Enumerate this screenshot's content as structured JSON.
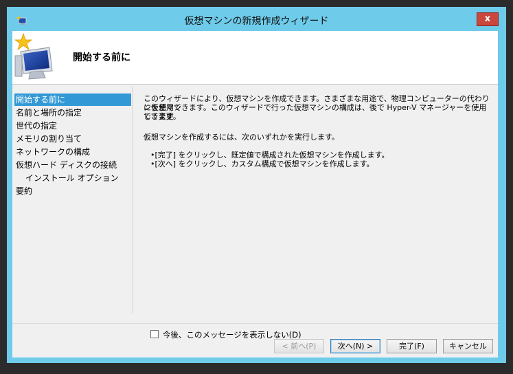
{
  "window": {
    "title": "仮想マシンの新規作成ウィザード",
    "close_label": "x"
  },
  "header": {
    "title": "開始する前に"
  },
  "nav": {
    "items": [
      {
        "label": "開始する前に",
        "selected": true
      },
      {
        "label": "名前と場所の指定",
        "selected": false
      },
      {
        "label": "世代の指定",
        "selected": false
      },
      {
        "label": "メモリの割り当て",
        "selected": false
      },
      {
        "label": "ネットワークの構成",
        "selected": false
      },
      {
        "label": "仮想ハード ディスクの接続",
        "selected": false
      },
      {
        "label": "インストール オプション",
        "selected": false
      },
      {
        "label": "要約",
        "selected": false
      }
    ]
  },
  "content": {
    "intro_line1": "このウィザードにより、仮想マシンを作成できます。さまざまな用途で、物理コンピューターの代わりに仮想マシ",
    "intro_line2": "ンを使用できます。このウィザードで行った仮想マシンの構成は、後で Hyper-V マネージャーを使用して変更",
    "intro_line3": "できます。",
    "instruction": "仮想マシンを作成するには、次のいずれかを実行します。",
    "bullet1": "•[完了] をクリックし、既定値で構成された仮想マシンを作成します。",
    "bullet2": "•[次へ] をクリックし、カスタム構成で仮想マシンを作成します。"
  },
  "checkbox": {
    "label": "今後、このメッセージを表示しない(D)",
    "checked": false
  },
  "buttons": {
    "prev": "< 前へ(P)",
    "next": "次へ(N) >",
    "finish": "完了(F)",
    "cancel": "キャンセル"
  },
  "colors": {
    "frame": "#6ecbea",
    "selection": "#3399d6",
    "close": "#c9473d"
  }
}
